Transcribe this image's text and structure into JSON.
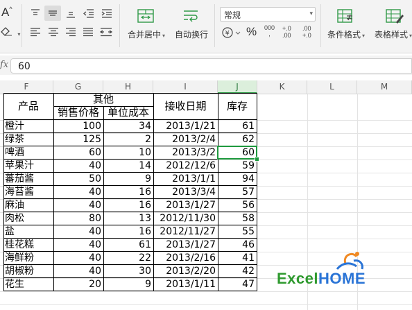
{
  "ribbon": {
    "merge_center": "合并居中",
    "wrap_text": "自动换行",
    "number_format": "常规",
    "cond_format": "条件格式",
    "table_style": "表格样式",
    "percent": "%",
    "thousands": "000",
    "inc_decimal": "+.0 .00",
    "dec_decimal": ".00 +.0"
  },
  "formula_bar": {
    "fx": "fx",
    "value": "60"
  },
  "columns": [
    "F",
    "G",
    "H",
    "I",
    "J",
    "K",
    "L",
    "M"
  ],
  "table": {
    "header": {
      "product": "产品",
      "other": "其他",
      "price": "销售价格",
      "cost": "单位成本",
      "date": "接收日期",
      "stock": "库存"
    },
    "rows": [
      {
        "product": "橙汁",
        "price": "100",
        "cost": "34",
        "date": "2013/1/21",
        "stock": "61"
      },
      {
        "product": "绿茶",
        "price": "125",
        "cost": "2",
        "date": "2013/2/4",
        "stock": "62"
      },
      {
        "product": "啤酒",
        "price": "60",
        "cost": "10",
        "date": "2013/3/2",
        "stock": "60"
      },
      {
        "product": "苹果汁",
        "price": "40",
        "cost": "14",
        "date": "2012/12/6",
        "stock": "59"
      },
      {
        "product": "蕃茄酱",
        "price": "50",
        "cost": "9",
        "date": "2013/1/1",
        "stock": "94"
      },
      {
        "product": "海苔酱",
        "price": "40",
        "cost": "16",
        "date": "2013/3/4",
        "stock": "57"
      },
      {
        "product": "麻油",
        "price": "40",
        "cost": "16",
        "date": "2013/1/27",
        "stock": "56"
      },
      {
        "product": "肉松",
        "price": "80",
        "cost": "13",
        "date": "2012/11/30",
        "stock": "58"
      },
      {
        "product": "盐",
        "price": "40",
        "cost": "16",
        "date": "2012/11/27",
        "stock": "55"
      },
      {
        "product": "桂花糕",
        "price": "40",
        "cost": "61",
        "date": "2013/1/27",
        "stock": "46"
      },
      {
        "product": "海鲜粉",
        "price": "40",
        "cost": "22",
        "date": "2013/2/16",
        "stock": "41"
      },
      {
        "product": "胡椒粉",
        "price": "40",
        "cost": "30",
        "date": "2013/2/20",
        "stock": "42"
      },
      {
        "product": "花生",
        "price": "20",
        "cost": "9",
        "date": "2013/1/11",
        "stock": "47"
      }
    ]
  },
  "logo": {
    "part1": "Excel",
    "part2": "HOME"
  },
  "colors": {
    "selection": "#1e9a3e",
    "logo_green": "#2f9a2f",
    "logo_blue": "#2a74d6"
  }
}
